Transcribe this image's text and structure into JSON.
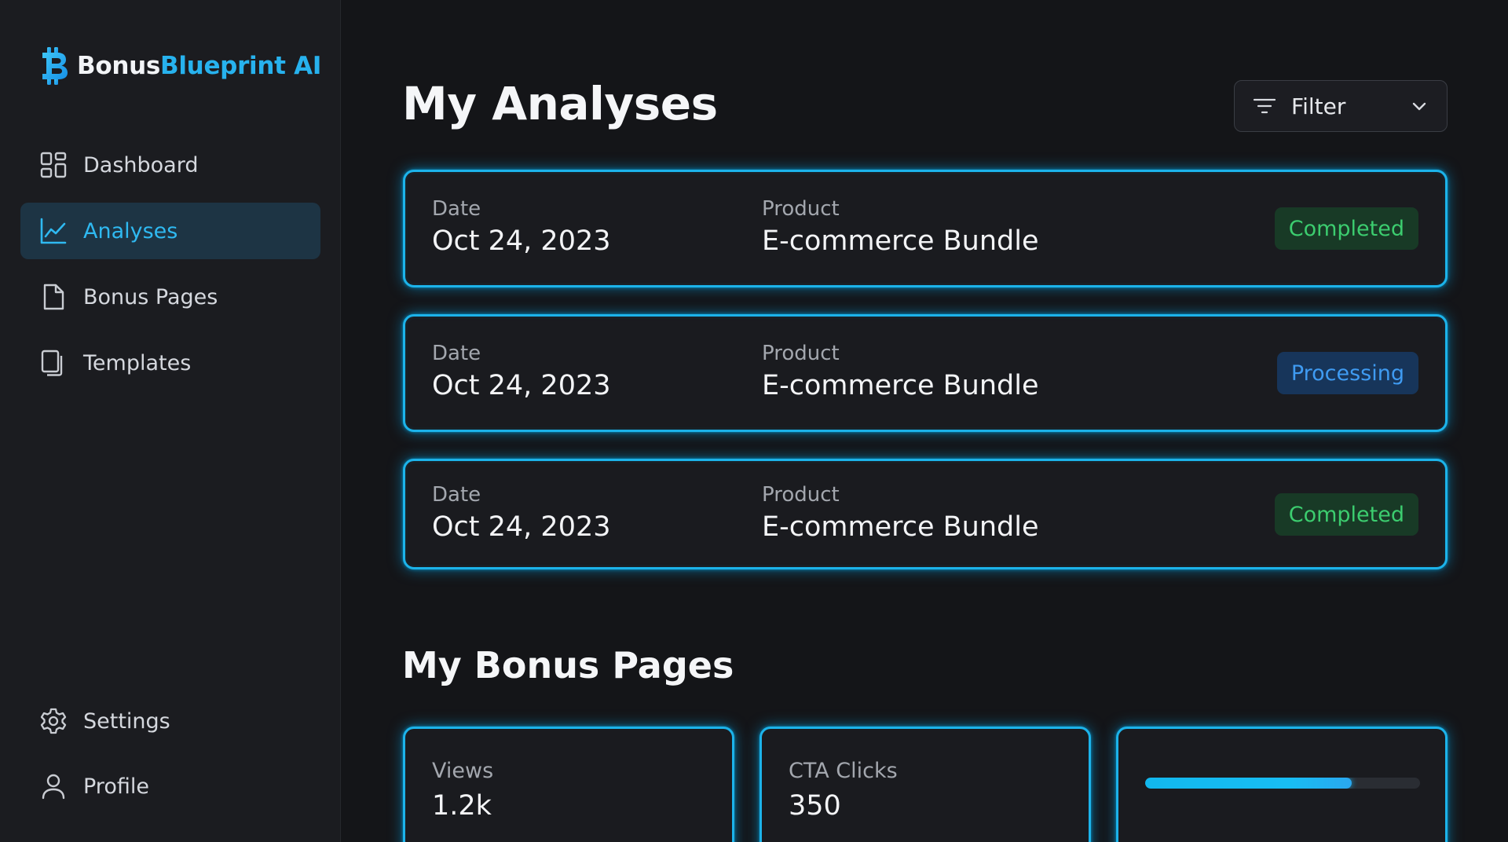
{
  "brand": {
    "name_part1": "Bonus",
    "name_part2": "Blueprint AI",
    "accent_color": "#27b2ee"
  },
  "sidebar": {
    "items": [
      {
        "label": "Dashboard",
        "icon": "dashboard-grid-icon",
        "active": false
      },
      {
        "label": "Analyses",
        "icon": "line-chart-icon",
        "active": true
      },
      {
        "label": "Bonus Pages",
        "icon": "document-icon",
        "active": false
      },
      {
        "label": "Templates",
        "icon": "copy-icon",
        "active": false
      }
    ],
    "bottom_items": [
      {
        "label": "Settings",
        "icon": "gear-icon"
      },
      {
        "label": "Profile",
        "icon": "user-icon"
      }
    ]
  },
  "main": {
    "title": "My Analyses",
    "filter": {
      "label": "Filter",
      "icon": "filter-icon"
    },
    "analyses": [
      {
        "date_label": "Date",
        "date": "Oct 24, 2023",
        "product_label": "Product",
        "product": "E-commerce Bundle",
        "status": "Completed",
        "status_color": "#3ccd6f"
      },
      {
        "date_label": "Date",
        "date": "Oct 24, 2023",
        "product_label": "Product",
        "product": "E-commerce Bundle",
        "status": "Processing",
        "status_color": "#3f9bf2"
      },
      {
        "date_label": "Date",
        "date": "Oct 24, 2023",
        "product_label": "Product",
        "product": "E-commerce Bundle",
        "status": "Completed",
        "status_color": "#3ccd6f"
      }
    ],
    "bonus_pages_title": "My Bonus Pages",
    "bonus_stats": [
      {
        "label": "Views",
        "value": "1.2k"
      },
      {
        "label": "CTA Clicks",
        "value": "350"
      }
    ],
    "bonus_progress": 0.75
  }
}
